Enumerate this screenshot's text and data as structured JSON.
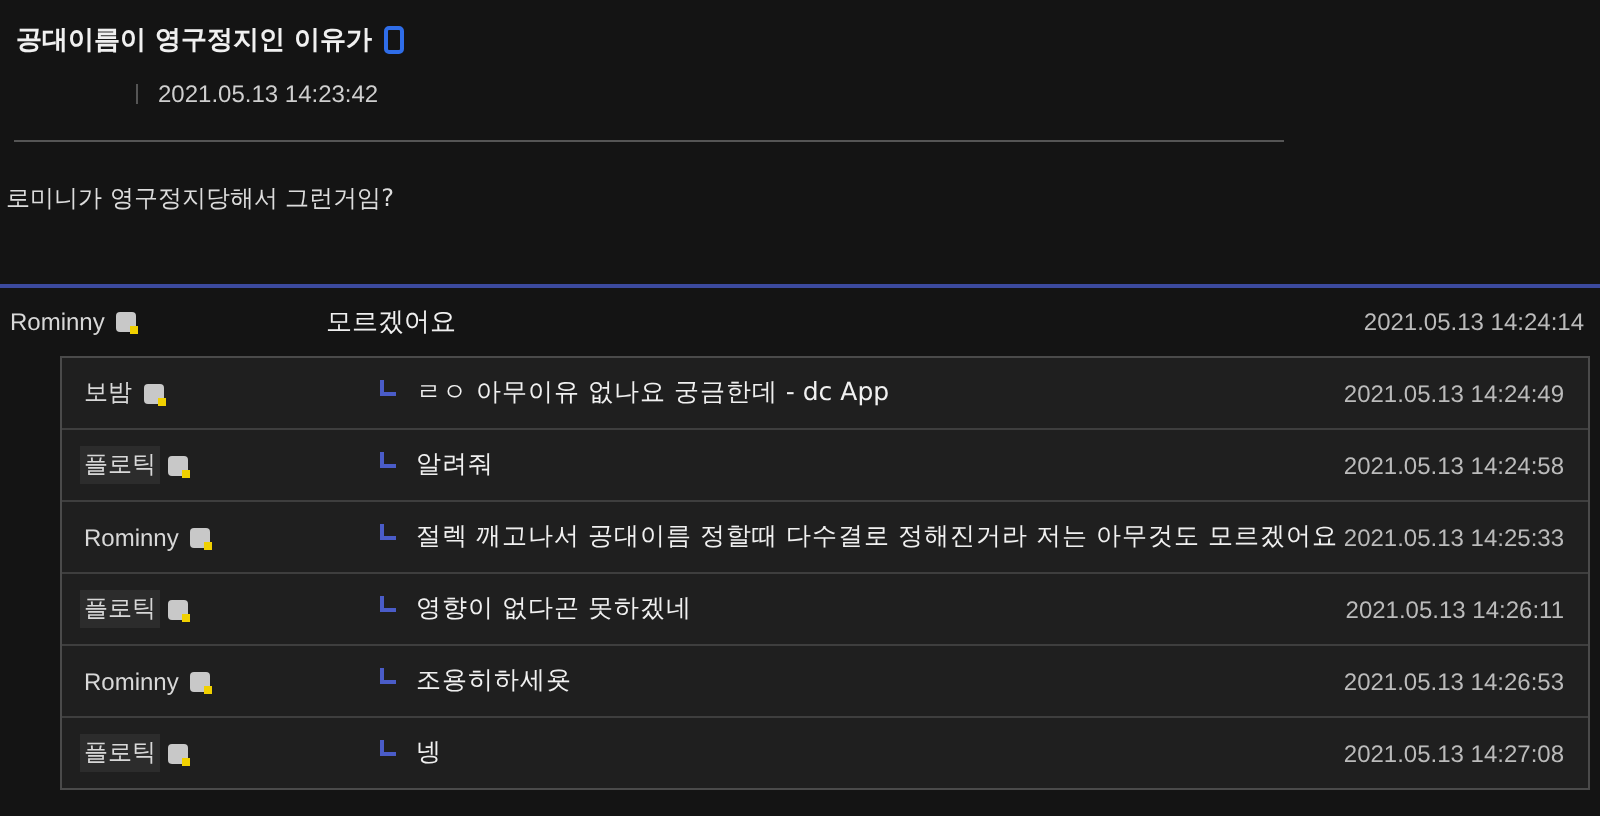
{
  "post": {
    "title": "공대이름이 영구정지인 이유가",
    "date": "2021.05.13 14:23:42",
    "body": "로미니가 영구정지당해서 그런거임?"
  },
  "comment": {
    "nick": "Rominny",
    "highlighted": false,
    "text": "모르겠어요",
    "date": "2021.05.13 14:24:14"
  },
  "replies": [
    {
      "nick": "보밤",
      "highlighted": false,
      "text": "ㄹㅇ 아무이유 없나요 궁금한데 - dc App",
      "date": "2021.05.13 14:24:49"
    },
    {
      "nick": "플로틱",
      "highlighted": true,
      "text": "알려줘",
      "date": "2021.05.13 14:24:58"
    },
    {
      "nick": "Rominny",
      "highlighted": false,
      "text": "절렉 깨고나서 공대이름 정할때 다수결로 정해진거라 저는 아무것도 모르겠어요",
      "date": "2021.05.13 14:25:33"
    },
    {
      "nick": "플로틱",
      "highlighted": true,
      "text": "영향이 없다곤 못하겠네",
      "date": "2021.05.13 14:26:11"
    },
    {
      "nick": "Rominny",
      "highlighted": false,
      "text": "조용히하세욧",
      "date": "2021.05.13 14:26:53"
    },
    {
      "nick": "플로틱",
      "highlighted": true,
      "text": "넹",
      "date": "2021.05.13 14:27:08"
    }
  ]
}
